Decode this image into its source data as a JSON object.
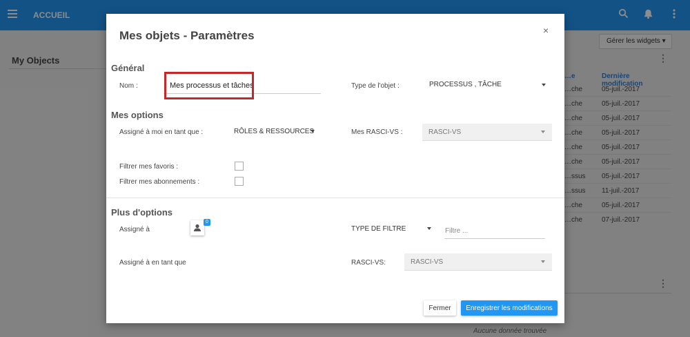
{
  "topbar": {
    "title": "ACCUEIL",
    "icons": [
      "menu-icon",
      "search-icon",
      "bell-icon",
      "more-vert-icon"
    ]
  },
  "background": {
    "left_title": "My Objects",
    "widgets_button": "Gérer les widgets",
    "table": {
      "headers": [
        "…e",
        "Dernière modification"
      ],
      "rows": [
        [
          "…che",
          "05-juil.-2017"
        ],
        [
          "…che",
          "05-juil.-2017"
        ],
        [
          "…che",
          "05-juil.-2017"
        ],
        [
          "…che",
          "05-juil.-2017"
        ],
        [
          "…che",
          "05-juil.-2017"
        ],
        [
          "…che",
          "05-juil.-2017"
        ],
        [
          "…ssus",
          "05-juil.-2017"
        ],
        [
          "…ssus",
          "11-juil.-2017"
        ],
        [
          "…che",
          "05-juil.-2017"
        ],
        [
          "…che",
          "07-juil.-2017"
        ]
      ]
    },
    "no_data": "Aucune donnée trouvée"
  },
  "modal": {
    "title": "Mes objets - Paramètres",
    "close_glyph": "×",
    "general": {
      "heading": "Général",
      "name_label": "Nom :",
      "name_value": "Mes processus et tâches",
      "type_label": "Type de l'objet :",
      "type_value": "PROCESSUS , TÂCHE"
    },
    "my_options": {
      "heading": "Mes options",
      "assigned_label": "Assigné à moi en tant que :",
      "assigned_value": "RÔLES & RESSOURCES",
      "rascivs_label": "Mes RASCI-VS :",
      "rascivs_value": "RASCI-VS",
      "favorites_label": "Filtrer mes favoris :",
      "subscriptions_label": "Filtrer mes abonnements :"
    },
    "more_options": {
      "heading": "Plus d'options",
      "assigned_to_label": "Assigné à",
      "assigned_count": "0",
      "filter_type_value": "TYPE DE FILTRE",
      "filter_placeholder": "Filtre ...",
      "assigned_as_label": "Assigné à en tant que",
      "rascivs_label": "RASCI-VS:",
      "rascivs_value": "RASCI-VS"
    },
    "buttons": {
      "close": "Fermer",
      "save": "Enregistrer les modifications"
    }
  },
  "colors": {
    "brand": "#2196f3",
    "highlight": "#c62828"
  }
}
